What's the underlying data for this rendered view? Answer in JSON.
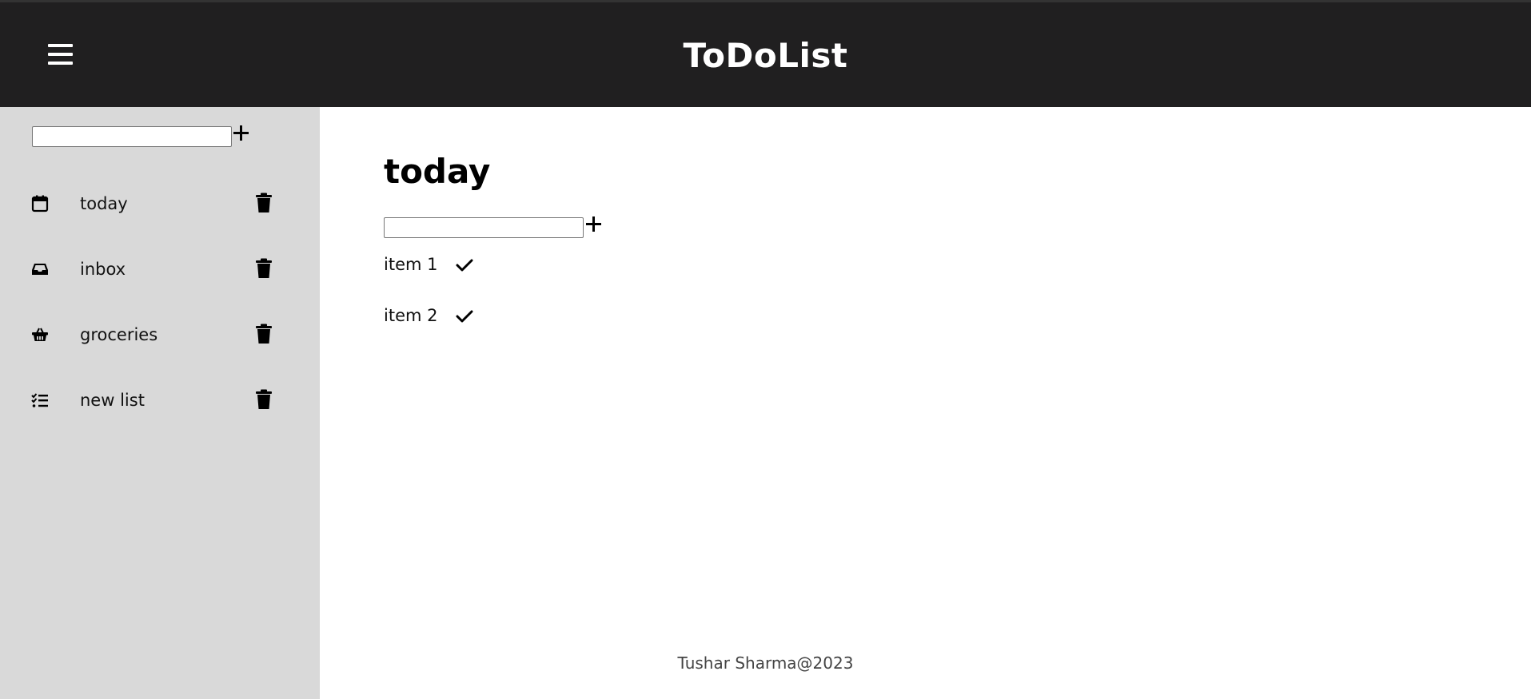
{
  "header": {
    "title": "ToDoList",
    "menu_icon": "hamburger-menu-icon"
  },
  "sidebar": {
    "new_list_value": "",
    "add_icon": "plus-icon",
    "items": [
      {
        "label": "today",
        "icon": "calendar-icon"
      },
      {
        "label": "inbox",
        "icon": "inbox-icon"
      },
      {
        "label": "groceries",
        "icon": "basket-icon"
      },
      {
        "label": "new list",
        "icon": "checklist-icon"
      }
    ],
    "delete_icon": "trash-icon"
  },
  "main": {
    "title": "today",
    "new_item_value": "",
    "tasks": [
      {
        "label": "item 1",
        "icon": "check-icon"
      },
      {
        "label": "item 2",
        "icon": "check-icon"
      }
    ]
  },
  "footer": {
    "text": "Tushar Sharma@2023"
  },
  "colors": {
    "header_bg": "#201f20",
    "sidebar_bg": "#d9d9d9",
    "main_bg": "#ffffff"
  }
}
